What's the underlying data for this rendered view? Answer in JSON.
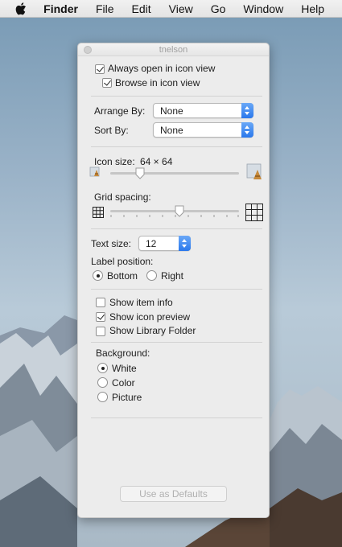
{
  "menubar": {
    "app": "Finder",
    "items": [
      "File",
      "Edit",
      "View",
      "Go",
      "Window",
      "Help"
    ]
  },
  "window": {
    "title": "tnelson"
  },
  "view_options": {
    "always_open_icon_view": {
      "label": "Always open in icon view",
      "checked": true
    },
    "browse_icon_view": {
      "label": "Browse in icon view",
      "checked": true
    },
    "arrange_by": {
      "label": "Arrange By:",
      "value": "None"
    },
    "sort_by": {
      "label": "Sort By:",
      "value": "None"
    },
    "icon_size": {
      "label": "Icon size:",
      "value": "64 × 64"
    },
    "grid_spacing": {
      "label": "Grid spacing:"
    },
    "text_size": {
      "label": "Text size:",
      "value": "12"
    },
    "label_position": {
      "label": "Label position:",
      "options": [
        {
          "label": "Bottom",
          "selected": true
        },
        {
          "label": "Right",
          "selected": false
        }
      ]
    },
    "show_item_info": {
      "label": "Show item info",
      "checked": false
    },
    "show_icon_preview": {
      "label": "Show icon preview",
      "checked": true
    },
    "show_library_folder": {
      "label": "Show Library Folder",
      "checked": false
    },
    "background": {
      "label": "Background:",
      "options": [
        {
          "label": "White",
          "selected": true
        },
        {
          "label": "Color",
          "selected": false
        },
        {
          "label": "Picture",
          "selected": false
        }
      ]
    },
    "use_as_defaults": "Use as Defaults"
  },
  "colors": {
    "accent": "#2a78ec",
    "panel_bg": "#ececec"
  }
}
